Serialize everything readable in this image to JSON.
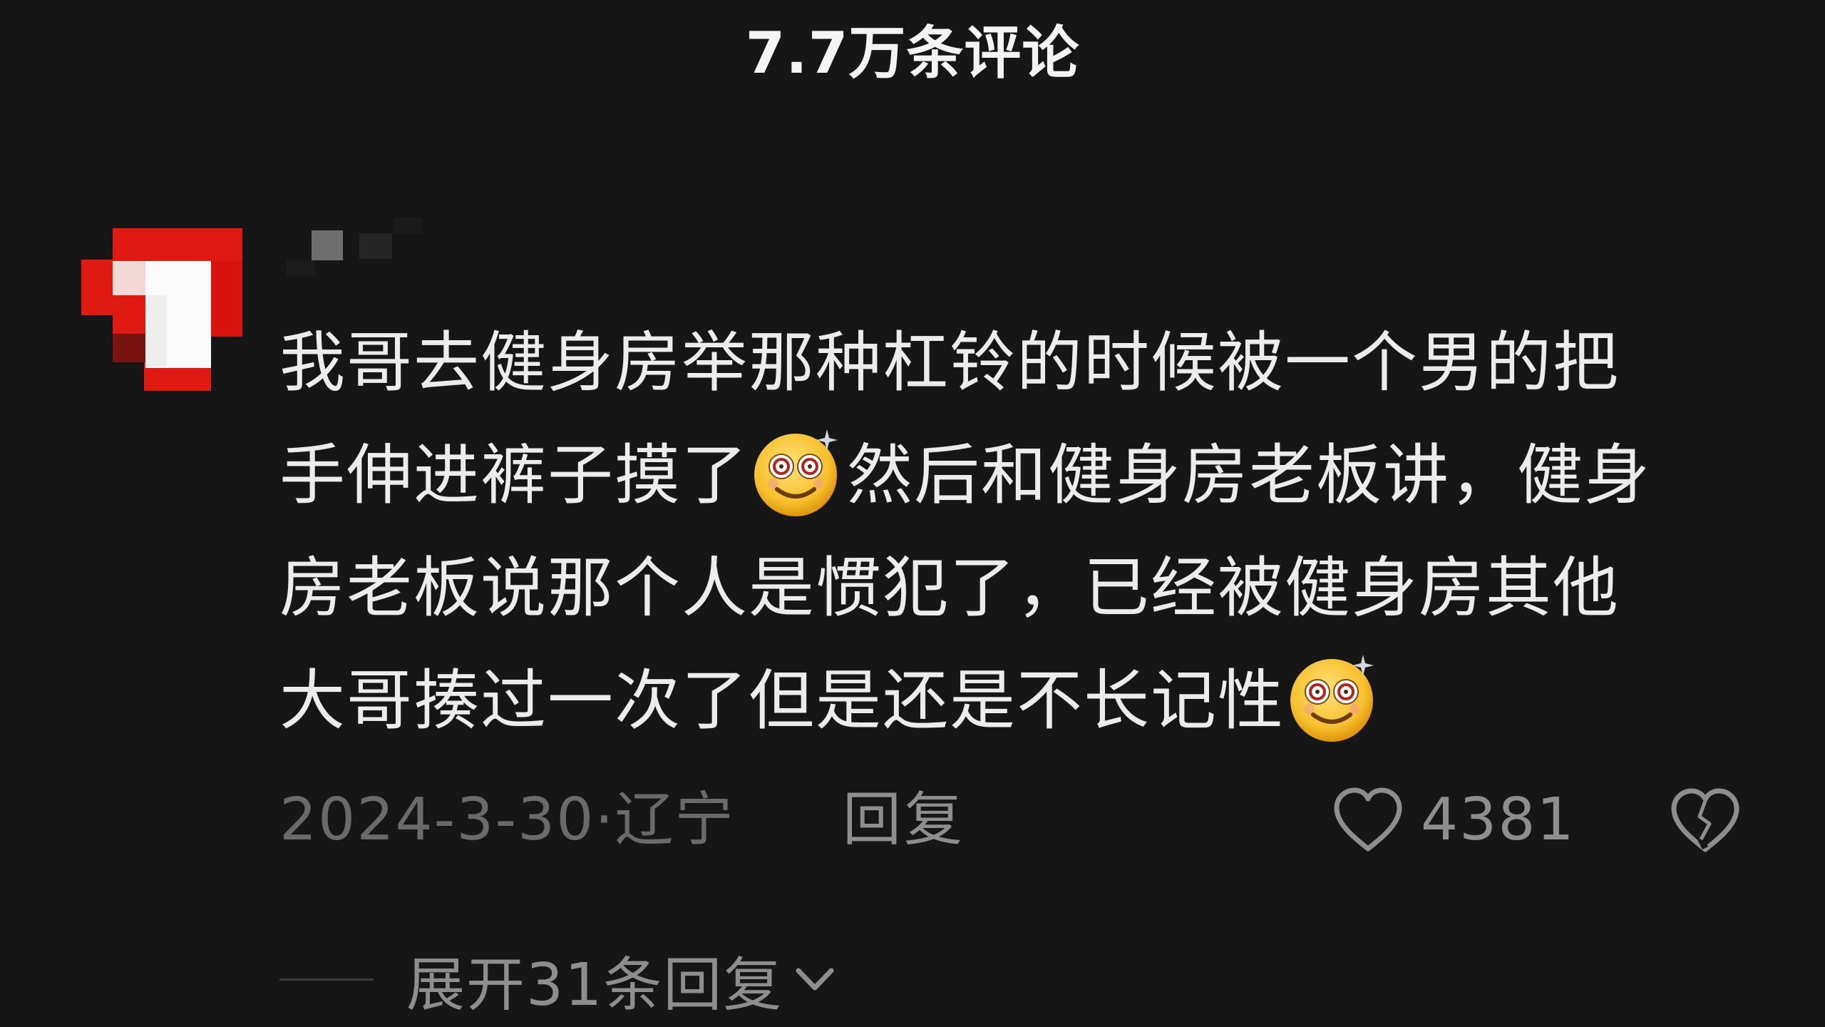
{
  "header": {
    "title": "7.7万条评论"
  },
  "comment": {
    "avatar_icon": "avatar-pixelated",
    "username_icon": "username-pixelated",
    "lines": [
      {
        "segments": [
          {
            "text": "我哥去健身房举那种杠铃的时候被一个男的把"
          }
        ]
      },
      {
        "segments": [
          {
            "text": "手伸进裤子摸了"
          },
          {
            "emoji": "dizzy-face-emoji"
          },
          {
            "text": "然后和健身房老板讲，健身"
          }
        ]
      },
      {
        "segments": [
          {
            "text": "房老板说那个人是惯犯了，已经被健身房其他"
          }
        ]
      },
      {
        "segments": [
          {
            "text": "大哥揍过一次了但是还是不长记性"
          },
          {
            "emoji": "dizzy-face-emoji"
          }
        ]
      }
    ],
    "date": "2024-3-30",
    "separator": "·",
    "location": "辽宁",
    "reply_label": "回复",
    "like_count": "4381",
    "like_icon": "heart-icon",
    "dislike_icon": "broken-heart-icon",
    "expand_label": "展开31条回复",
    "expand_icon": "chevron-down-icon"
  },
  "colors": {
    "background": "#161616",
    "text_primary": "#ececec",
    "text_secondary": "#8e8e8e",
    "text_tertiary": "#6a6a6a",
    "avatar_red": "#e11b14"
  }
}
